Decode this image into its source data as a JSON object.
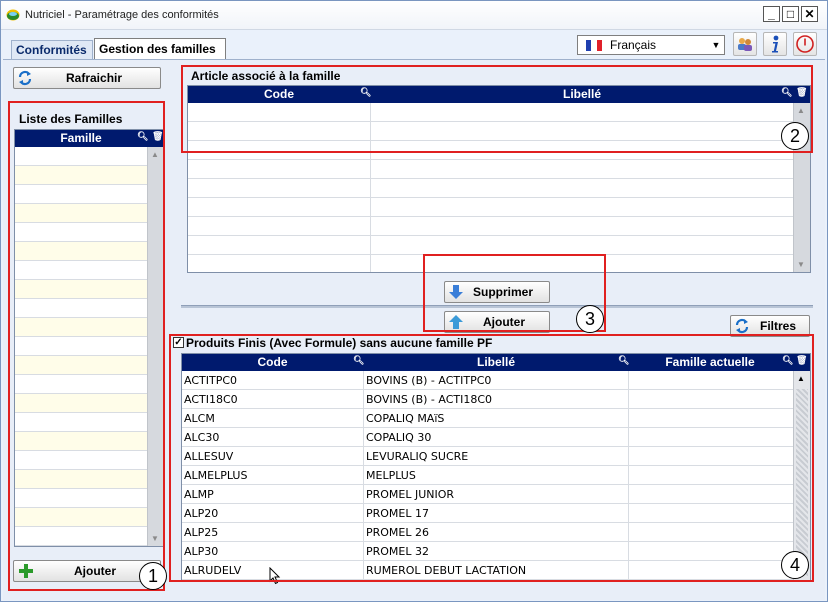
{
  "window": {
    "title": "Nutriciel - Paramétrage des conformités",
    "minimize": "_",
    "maximize": "□",
    "close": "✕"
  },
  "tabs": [
    {
      "label": "Conformités"
    },
    {
      "label": "Gestion des familles"
    }
  ],
  "language": {
    "selected": "Français"
  },
  "left": {
    "refresh_label": "Rafraichir",
    "group_title": "Liste des Familles",
    "column": "Famille",
    "add_label": "Ajouter"
  },
  "article": {
    "group_title": "Article associé à la famille",
    "columns": [
      "Code",
      "Libellé"
    ]
  },
  "actions": {
    "delete_label": "Supprimer",
    "add_label": "Ajouter",
    "filters_label": "Filtres"
  },
  "products": {
    "checkbox_label": "Produits Finis (Avec Formule) sans aucune famille PF",
    "checked": true,
    "columns": [
      "Code",
      "Libellé",
      "Famille actuelle"
    ],
    "rows": [
      {
        "code": "ACTITPC0",
        "libelle": "BOVINS (B) - ACTITPC0",
        "famille": ""
      },
      {
        "code": "ACTI18C0",
        "libelle": "BOVINS (B) - ACTI18C0",
        "famille": ""
      },
      {
        "code": "ALCM",
        "libelle": "COPALIQ MAïS",
        "famille": ""
      },
      {
        "code": "ALC30",
        "libelle": "COPALIQ 30",
        "famille": ""
      },
      {
        "code": "ALLESUV",
        "libelle": "LEVURALIQ SUCRE",
        "famille": ""
      },
      {
        "code": "ALMELPLUS",
        "libelle": "MELPLUS",
        "famille": ""
      },
      {
        "code": "ALMP",
        "libelle": "PROMEL JUNIOR",
        "famille": ""
      },
      {
        "code": "ALP20",
        "libelle": "PROMEL 17",
        "famille": ""
      },
      {
        "code": "ALP25",
        "libelle": "PROMEL 26",
        "famille": ""
      },
      {
        "code": "ALP30",
        "libelle": "PROMEL 32",
        "famille": ""
      },
      {
        "code": "ALRUDELV",
        "libelle": "RUMEROL DEBUT LACTATION",
        "famille": ""
      }
    ]
  },
  "callouts": [
    "1",
    "2",
    "3",
    "4"
  ],
  "colors": {
    "grid_header": "#001a6e",
    "annotation": "#e02020",
    "row_alt": "#fffde9"
  }
}
